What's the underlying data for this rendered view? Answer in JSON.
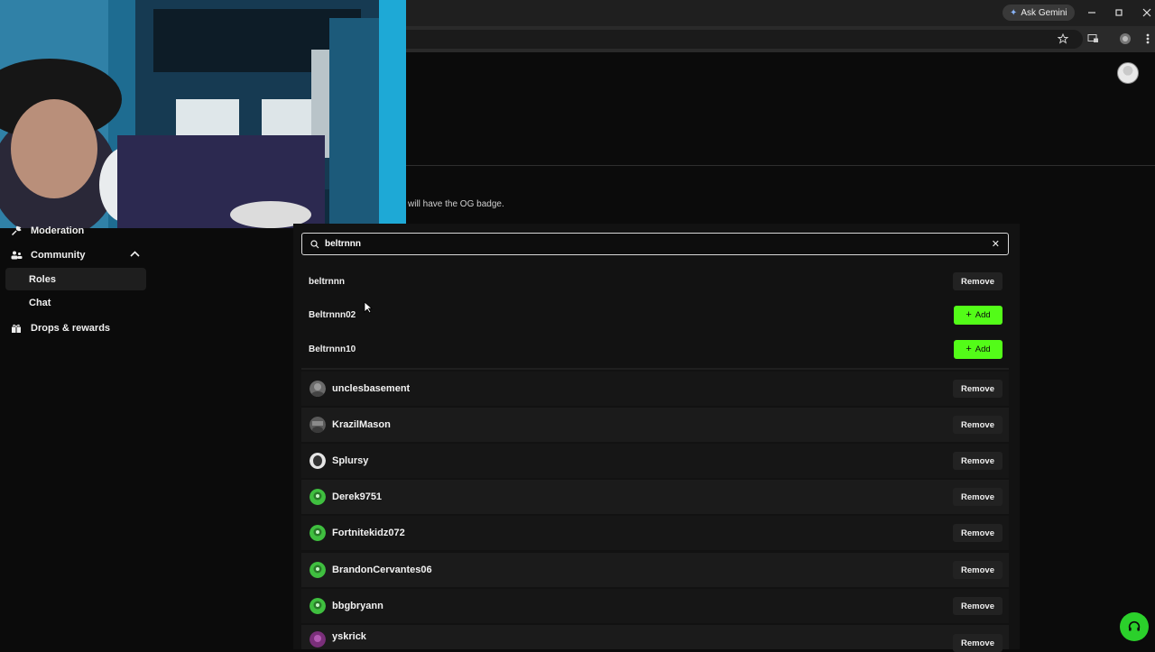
{
  "browser": {
    "gemini_label": "Ask Gemini"
  },
  "page": {
    "og_description": "will have the OG badge."
  },
  "sidebar": {
    "items": [
      {
        "label": "Moderation",
        "icon": "wrench-icon"
      },
      {
        "label": "Community",
        "icon": "users-icon",
        "expanded": true
      },
      {
        "label": "Roles",
        "active": true
      },
      {
        "label": "Chat"
      },
      {
        "label": "Drops & rewards",
        "icon": "gift-icon"
      }
    ]
  },
  "search": {
    "value": "beltrnnn"
  },
  "results": [
    {
      "name": "beltrnnn",
      "action": "Remove"
    },
    {
      "name": "Beltrnnn02",
      "action": "Add"
    },
    {
      "name": "Beltrnnn10",
      "action": "Add"
    }
  ],
  "members": [
    {
      "name": "unclesbasement",
      "action": "Remove",
      "avatar_color": "#6b6b6b"
    },
    {
      "name": "KrazilMason",
      "action": "Remove",
      "avatar_color": "#5a5a5a"
    },
    {
      "name": "Splursy",
      "action": "Remove",
      "avatar_color": "#e5e5e5"
    },
    {
      "name": "Derek9751",
      "action": "Remove",
      "avatar_color": "#3fbf3f"
    },
    {
      "name": "Fortnitekidz072",
      "action": "Remove",
      "avatar_color": "#3fbf3f"
    },
    {
      "name": "BrandonCervantes06",
      "action": "Remove",
      "avatar_color": "#3fbf3f"
    },
    {
      "name": "bbgbryann",
      "action": "Remove",
      "avatar_color": "#3fbf3f"
    },
    {
      "name": "yskrick",
      "action": "Remove",
      "avatar_color": "#7a2f7a"
    }
  ],
  "colors": {
    "accent": "#53fc18",
    "background": "#0b0b0b"
  }
}
